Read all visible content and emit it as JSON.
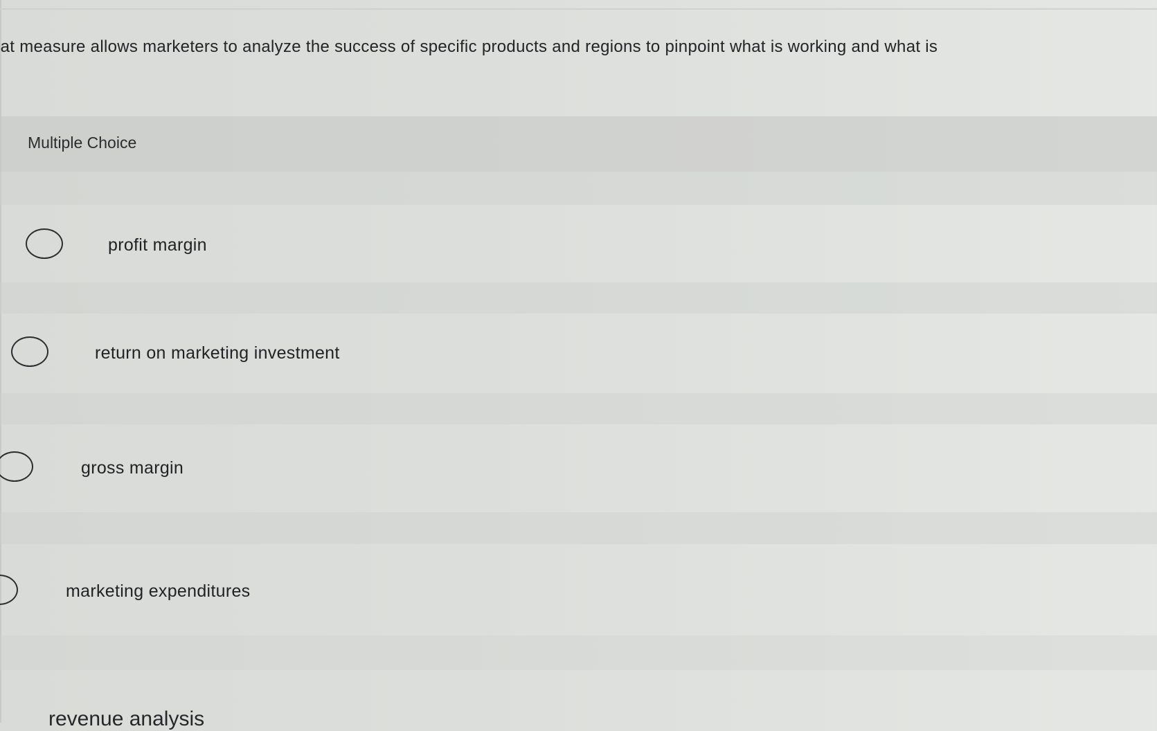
{
  "question": {
    "text": "hat measure allows marketers to analyze the success of specific products and regions to pinpoint what is working and what is"
  },
  "question_type": "Multiple Choice",
  "options": [
    {
      "label": "profit margin"
    },
    {
      "label": "return on marketing investment"
    },
    {
      "label": "gross margin"
    },
    {
      "label": "marketing expenditures"
    },
    {
      "label": "revenue analysis"
    }
  ]
}
